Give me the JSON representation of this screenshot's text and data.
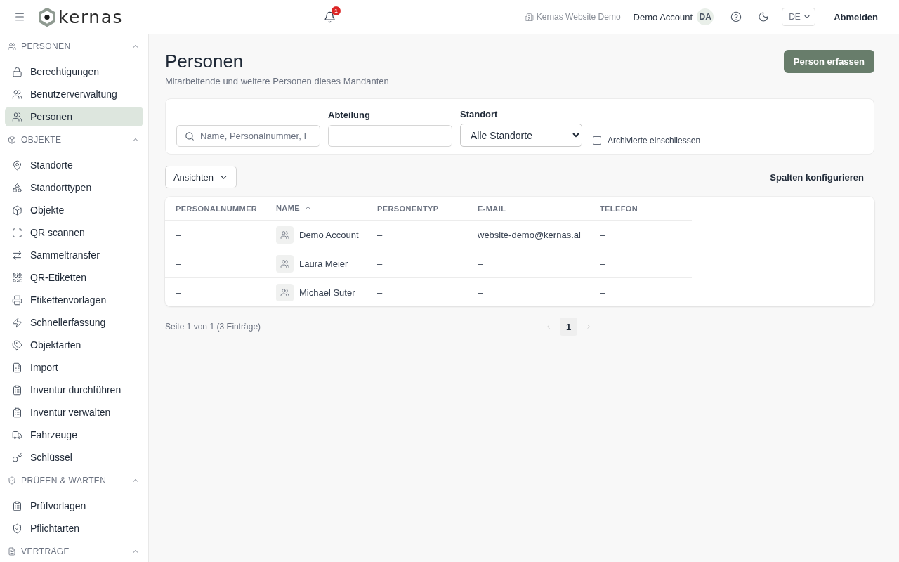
{
  "topbar": {
    "logo_text": "kernas",
    "notifications": {
      "count": "1"
    },
    "tenant": "Kernas Website Demo",
    "user": "Demo Account",
    "avatar_initials": "DA",
    "language": "DE",
    "logout": "Abmelden"
  },
  "sidebar": {
    "sections": [
      {
        "title": "PERSONEN",
        "expanded": true,
        "items": [
          {
            "label": "Berechtigungen",
            "selected": false
          },
          {
            "label": "Benutzerverwaltung",
            "selected": false
          },
          {
            "label": "Personen",
            "selected": true
          }
        ]
      },
      {
        "title": "OBJEKTE",
        "expanded": true,
        "items": [
          {
            "label": "Standorte",
            "selected": false
          },
          {
            "label": "Standorttypen",
            "selected": false
          },
          {
            "label": "Objekte",
            "selected": false
          },
          {
            "label": "QR scannen",
            "selected": false
          },
          {
            "label": "Sammeltransfer",
            "selected": false
          },
          {
            "label": "QR-Etiketten",
            "selected": false
          },
          {
            "label": "Etikettenvorlagen",
            "selected": false
          },
          {
            "label": "Schnellerfassung",
            "selected": false
          },
          {
            "label": "Objektarten",
            "selected": false
          },
          {
            "label": "Import",
            "selected": false
          },
          {
            "label": "Inventur durchführen",
            "selected": false
          },
          {
            "label": "Inventur verwalten",
            "selected": false
          },
          {
            "label": "Fahrzeuge",
            "selected": false
          },
          {
            "label": "Schlüssel",
            "selected": false
          }
        ]
      },
      {
        "title": "PRÜFEN & WARTEN",
        "expanded": true,
        "items": [
          {
            "label": "Prüfvorlagen",
            "selected": false
          },
          {
            "label": "Pflichtarten",
            "selected": false
          }
        ]
      },
      {
        "title": "VERTRÄGE",
        "expanded": true
      }
    ]
  },
  "page": {
    "title": "Personen",
    "subtitle": "Mitarbeitende und weitere Personen dieses Mandanten",
    "primary_action": "Person erfassen"
  },
  "filters": {
    "search": {
      "placeholder": "Name, Personalnummer, I"
    },
    "department": {
      "label": "Abteilung"
    },
    "location": {
      "label": "Standort",
      "value": "Alle Standorte"
    },
    "archived": {
      "label": "Archivierte einschliessen",
      "checked": false
    }
  },
  "toolbar": {
    "views": "Ansichten",
    "configure_columns": "Spalten konfigurieren"
  },
  "table": {
    "columns": [
      {
        "label": "PERSONALNUMMER",
        "sorted": false
      },
      {
        "label": "NAME",
        "sorted": true
      },
      {
        "label": "PERSONENTYP",
        "sorted": false
      },
      {
        "label": "E-MAIL",
        "sorted": false
      },
      {
        "label": "TELEFON",
        "sorted": false
      }
    ],
    "rows": [
      {
        "personalnummer": "–",
        "name": "Demo Account",
        "personentyp": "–",
        "email": "website-demo@kernas.ai",
        "telefon": "–"
      },
      {
        "personalnummer": "–",
        "name": "Laura Meier",
        "personentyp": "–",
        "email": "–",
        "telefon": "–"
      },
      {
        "personalnummer": "–",
        "name": "Michael Suter",
        "personentyp": "–",
        "email": "–",
        "telefon": "–"
      }
    ]
  },
  "pagination": {
    "summary": "Seite 1 von 1 (3 Einträge)",
    "prev": {
      "disabled": true
    },
    "next": {
      "disabled": true
    },
    "pages": [
      {
        "label": "1",
        "selected": true
      }
    ]
  }
}
